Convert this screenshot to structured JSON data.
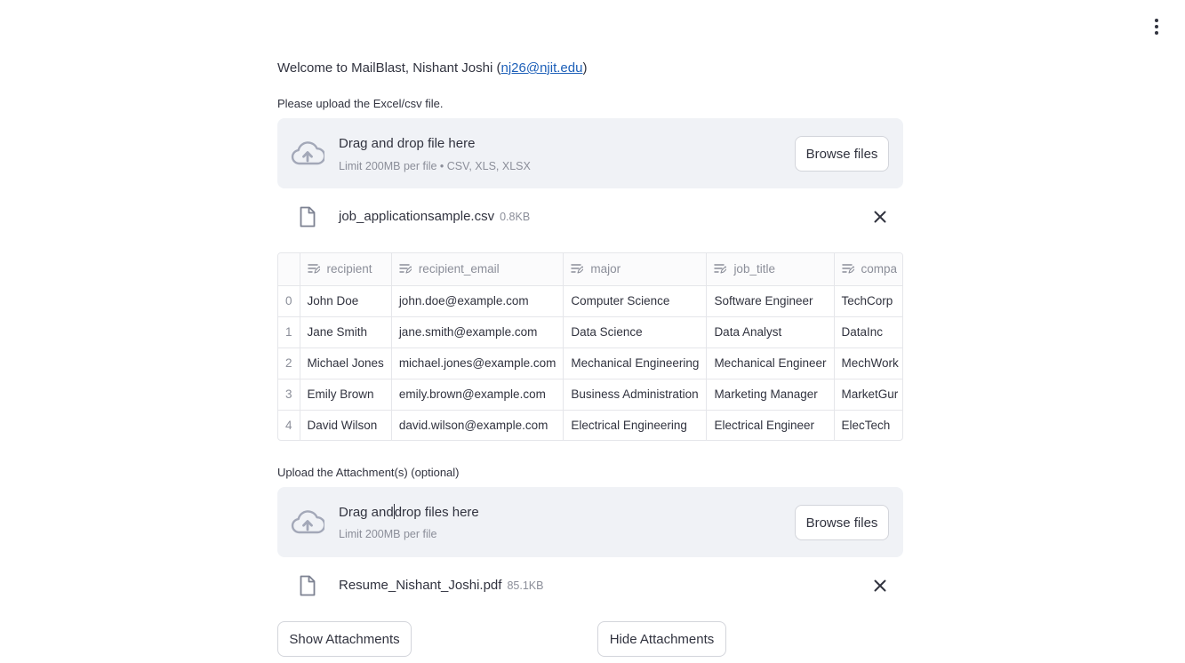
{
  "welcome": {
    "prefix": "Welcome to MailBlast, Nishant Joshi (",
    "email": "nj26@njit.edu",
    "suffix": ")"
  },
  "data_upload": {
    "label": "Please upload the Excel/csv file.",
    "title": "Drag and drop file here",
    "subtitle": "Limit 200MB per file • CSV, XLS, XLSX",
    "browse_label": "Browse files",
    "file": {
      "name": "job_applicationsample.csv",
      "size": "0.8KB"
    }
  },
  "table": {
    "columns": [
      "recipient",
      "recipient_email",
      "major",
      "job_title",
      "company"
    ],
    "column_display": [
      "recipient",
      "recipient_email",
      "major",
      "job_title",
      "compa"
    ],
    "rows": [
      {
        "index": "0",
        "cells": [
          "John Doe",
          "john.doe@example.com",
          "Computer Science",
          "Software Engineer",
          "TechCorp"
        ]
      },
      {
        "index": "1",
        "cells": [
          "Jane Smith",
          "jane.smith@example.com",
          "Data Science",
          "Data Analyst",
          "DataInc"
        ]
      },
      {
        "index": "2",
        "cells": [
          "Michael Jones",
          "michael.jones@example.com",
          "Mechanical Engineering",
          "Mechanical Engineer",
          "MechWork"
        ]
      },
      {
        "index": "3",
        "cells": [
          "Emily Brown",
          "emily.brown@example.com",
          "Business Administration",
          "Marketing Manager",
          "MarketGur"
        ]
      },
      {
        "index": "4",
        "cells": [
          "David Wilson",
          "david.wilson@example.com",
          "Electrical Engineering",
          "Electrical Engineer",
          "ElecTech"
        ]
      }
    ]
  },
  "attachment_upload": {
    "label": "Upload the Attachment(s) (optional)",
    "title_a": "Drag and",
    "title_b": "drop files here",
    "subtitle": "Limit 200MB per file",
    "browse_label": "Browse files",
    "file": {
      "name": "Resume_Nishant_Joshi.pdf",
      "size": "85.1KB"
    }
  },
  "buttons": {
    "show_attachments": "Show Attachments",
    "hide_attachments": "Hide Attachments"
  },
  "icons": {
    "menu": "vertical-dots-icon",
    "upload": "cloud-upload-icon",
    "file": "file-icon",
    "close": "close-icon",
    "column": "text-column-icon"
  },
  "colors": {
    "text": "#31333f",
    "muted": "#8b8e99",
    "dropzone_bg": "#f0f2f6",
    "link": "#1c5fb8",
    "border": "#d3d5db"
  }
}
